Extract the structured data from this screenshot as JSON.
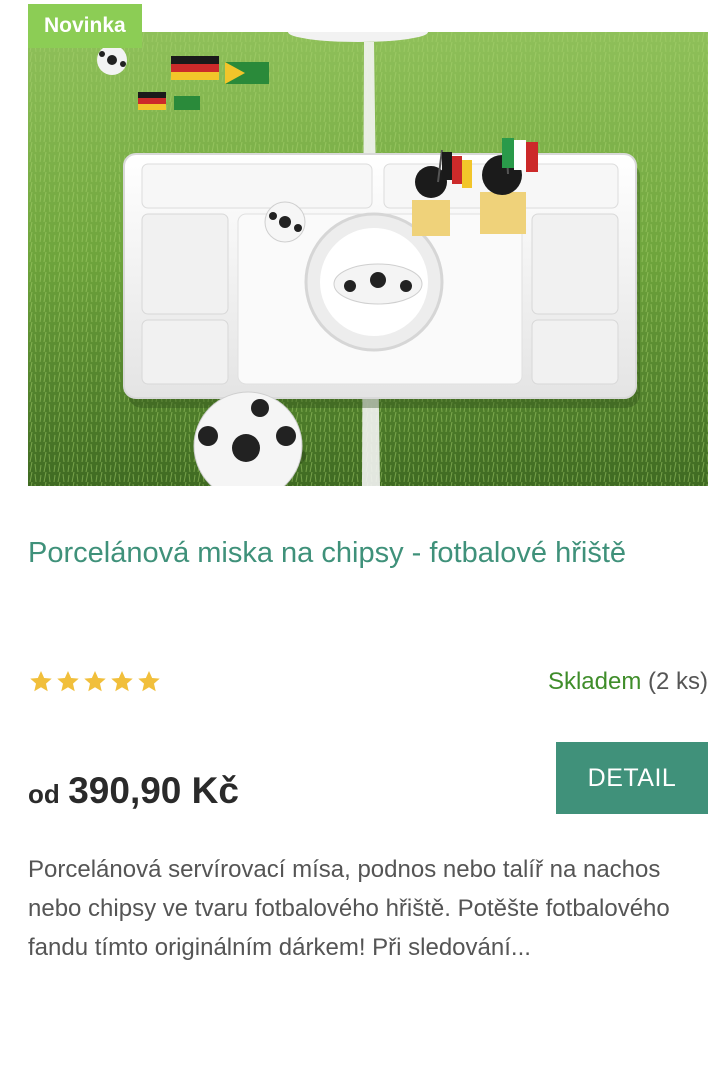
{
  "product": {
    "badge": "Novinka",
    "title": "Porcelánová miska na chipsy - fotbalové hřiště",
    "image_alt": "Porcelánová servírovací mísa ve tvaru fotbalového hřiště",
    "rating": {
      "stars": 5,
      "max": 5
    },
    "availability": {
      "status": "Skladem",
      "quantity": "(2 ks)"
    },
    "price": {
      "prefix": "od",
      "amount": "390,90 Kč"
    },
    "detail_button": "DETAIL",
    "description": "Porcelánová servírovací mísa, podnos nebo talíř na nachos nebo chipsy ve tvaru fotbalového hřiště.  Potěšte fotbalového fandu tímto originálním dárkem!  Při sledování..."
  },
  "colors": {
    "accent": "#40917a",
    "badge": "#8ccd55",
    "in_stock": "#3f8d2a",
    "star": "#f1bf3b"
  }
}
